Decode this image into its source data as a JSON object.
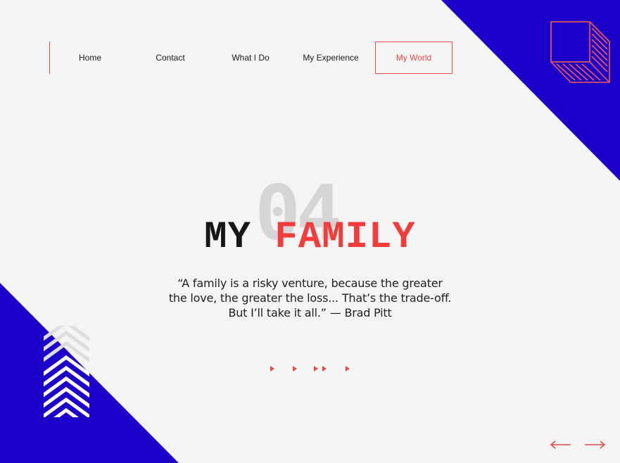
{
  "nav": {
    "items": [
      {
        "label": "Home"
      },
      {
        "label": "Contact"
      },
      {
        "label": "What I Do"
      },
      {
        "label": "My Experience"
      },
      {
        "label": "My World",
        "active": true
      }
    ]
  },
  "hero": {
    "number": "04",
    "title_word_1": "MY",
    "title_word_2": "FAMILY"
  },
  "quote": {
    "line1": "“A family is a risky venture, because the greater",
    "line2": "the love, the greater the loss... That’s the trade-off.",
    "line3": "But I’ll take it all.” — Brad Pitt"
  },
  "colors": {
    "accent": "#e64b4b",
    "title_red": "#f23b3b",
    "deco_blue": "#1c00c9",
    "background": "#f4f4f4"
  },
  "icons": {
    "play": "play-triangle-icon",
    "prev": "arrow-left-icon",
    "next": "arrow-right-icon",
    "cube": "cube-outline-icon",
    "chevrons": "chevron-stack-icon"
  }
}
